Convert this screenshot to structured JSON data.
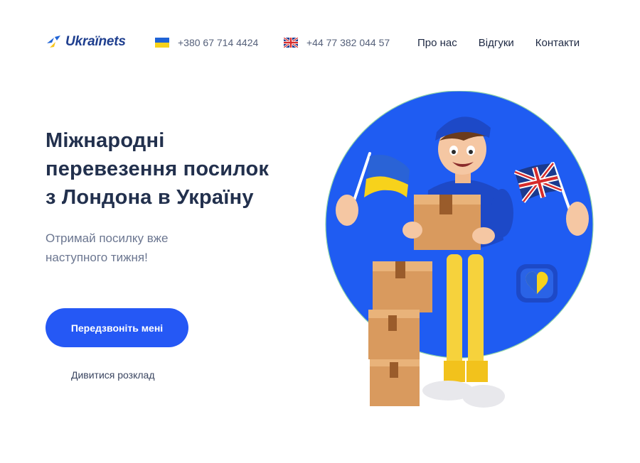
{
  "brand": {
    "name": "Ukraïnets"
  },
  "phones": [
    {
      "number": "+380 67 714 4424",
      "flag": "ua-flag-icon"
    },
    {
      "number": "+44 77 382 044 57",
      "flag": "gb-flag-icon"
    }
  ],
  "nav": {
    "items": [
      "Про нас",
      "Відгуки",
      "Контакти"
    ]
  },
  "hero": {
    "title_lines": [
      "Міжнародні",
      "перевезення посилок",
      "з Лондона в Україну"
    ],
    "subtitle_lines": [
      "Отримай посилку вже",
      "наступного тижня!"
    ],
    "cta_label": "Передзвоніть мені",
    "secondary_link": "Дивитися розклад"
  },
  "colors": {
    "accent": "#2558f5",
    "circle": "#1f5cf2",
    "title": "#22304d",
    "ua_blue": "#1f63d6",
    "ua_yellow": "#f7d21b"
  },
  "illustration": {
    "icons": [
      "courier-character-icon",
      "parcel-box-icon",
      "ukraine-flag-icon",
      "uk-flag-icon",
      "heart-badge-icon"
    ]
  }
}
